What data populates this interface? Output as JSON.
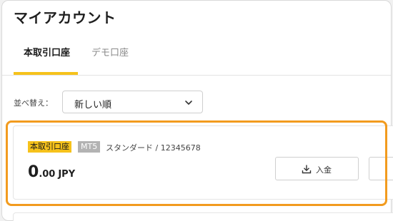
{
  "page": {
    "title": "マイアカウント"
  },
  "tabs": [
    {
      "label": "本取引口座",
      "active": true
    },
    {
      "label": "デモ口座",
      "active": false
    }
  ],
  "sort": {
    "label": "並べ替え：",
    "selected": "新しい順"
  },
  "account": {
    "badge_type": "本取引口座",
    "badge_platform": "MT5",
    "type_and_number": "スタンダード / 12345678",
    "balance_int": "0",
    "balance_dec": ".00",
    "currency": "JPY",
    "deposit_label": "入金"
  },
  "colors": {
    "accent": "#f6c21b",
    "highlight": "#f29b1e",
    "badge_gray": "#b3b3b3"
  },
  "icons": {
    "sort_chevron": "chevron-down-icon",
    "deposit": "download-icon"
  }
}
